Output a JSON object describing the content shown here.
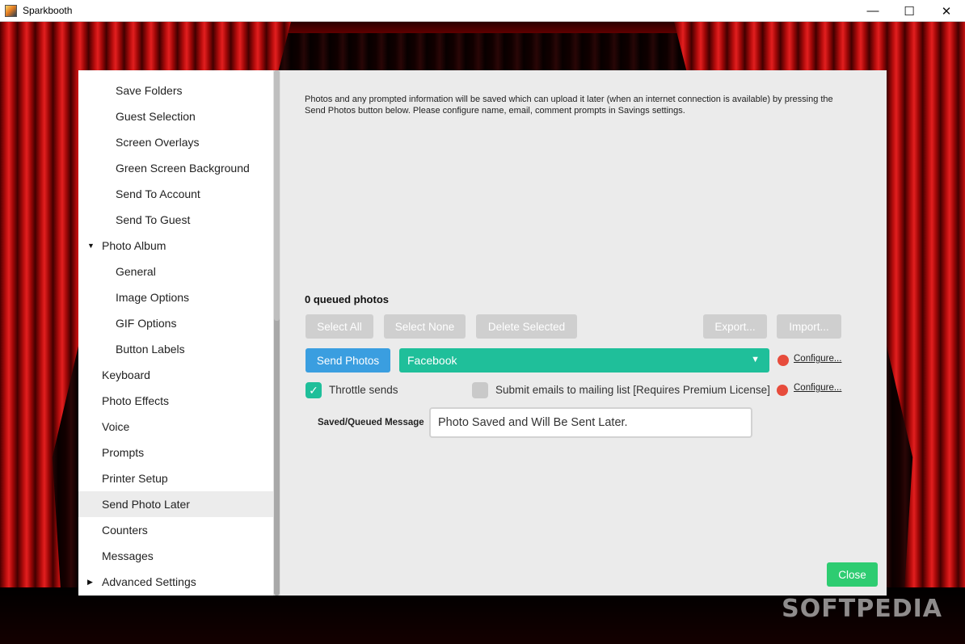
{
  "window": {
    "title": "Sparkbooth",
    "minimize_glyph": "—",
    "maximize_glyph": "☐",
    "close_glyph": "✕"
  },
  "sidebar": {
    "items": [
      {
        "label": "Save Folders",
        "level": "sub"
      },
      {
        "label": "Guest Selection",
        "level": "sub"
      },
      {
        "label": "Screen Overlays",
        "level": "sub"
      },
      {
        "label": "Green Screen Background",
        "level": "sub"
      },
      {
        "label": "Send To Account",
        "level": "sub"
      },
      {
        "label": "Send To Guest",
        "level": "sub"
      },
      {
        "label": "Photo Album",
        "level": "top",
        "expanded": true
      },
      {
        "label": "General",
        "level": "sub"
      },
      {
        "label": "Image Options",
        "level": "sub"
      },
      {
        "label": "GIF Options",
        "level": "sub"
      },
      {
        "label": "Button Labels",
        "level": "sub"
      },
      {
        "label": "Keyboard",
        "level": "top"
      },
      {
        "label": "Photo Effects",
        "level": "top"
      },
      {
        "label": "Voice",
        "level": "top"
      },
      {
        "label": "Prompts",
        "level": "top"
      },
      {
        "label": "Printer Setup",
        "level": "top"
      },
      {
        "label": "Send Photo Later",
        "level": "top",
        "active": true
      },
      {
        "label": "Counters",
        "level": "top"
      },
      {
        "label": "Messages",
        "level": "top"
      },
      {
        "label": "Advanced Settings",
        "level": "top",
        "collapsed": true
      }
    ],
    "expanded_icon": "▼",
    "collapsed_icon": "▶"
  },
  "main": {
    "description": "Photos and any prompted information will be saved which can upload it later (when an internet connection is available) by pressing the Send Photos button below. Please configure name, email, comment prompts in Savings settings.",
    "queued_text": "0 queued photos",
    "select_all_label": "Select All",
    "select_none_label": "Select None",
    "delete_selected_label": "Delete Selected",
    "export_label": "Export...",
    "import_label": "Import...",
    "send_photos_label": "Send Photos",
    "destination_value": "Facebook",
    "configure_label_1": "Configure...",
    "configure_label_2": "Configure...",
    "throttle_label": "Throttle sends",
    "throttle_checked": true,
    "mailing_label": "Submit emails to mailing list [Requires Premium License]",
    "mailing_checked": false,
    "message_label": "Saved/Queued Message",
    "message_value": "Photo Saved and Will Be Sent Later.",
    "close_label": "Close"
  },
  "watermark": "SOFTPEDIA",
  "colors": {
    "accent_teal": "#1fbf9a",
    "send_blue": "#3a9ee0",
    "close_green": "#2ecc71",
    "status_red": "#e74c3c"
  }
}
